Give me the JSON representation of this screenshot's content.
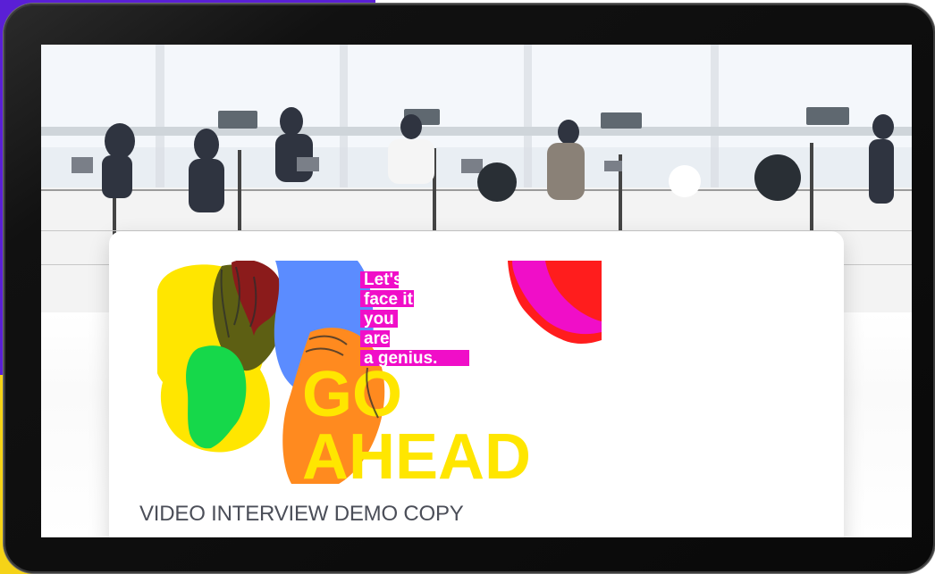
{
  "device": {
    "screen_title": "VIDEO INTERVIEW DEMO COPY"
  },
  "poster": {
    "line_1": "Let's",
    "line_2": "face it,",
    "line_3": "you",
    "line_4": "are",
    "line_5": "a genius.",
    "headline_1": "GO",
    "headline_2": "AHEAD"
  },
  "colors": {
    "purple_background": "#5a1fd6",
    "yellow_background": "#f5d317",
    "magenta": "#f00ec8",
    "yellow": "#ffe600",
    "blue": "#5b8cff",
    "green": "#16d84a",
    "orange": "#ff8a1f",
    "red": "#ff1d1d"
  }
}
